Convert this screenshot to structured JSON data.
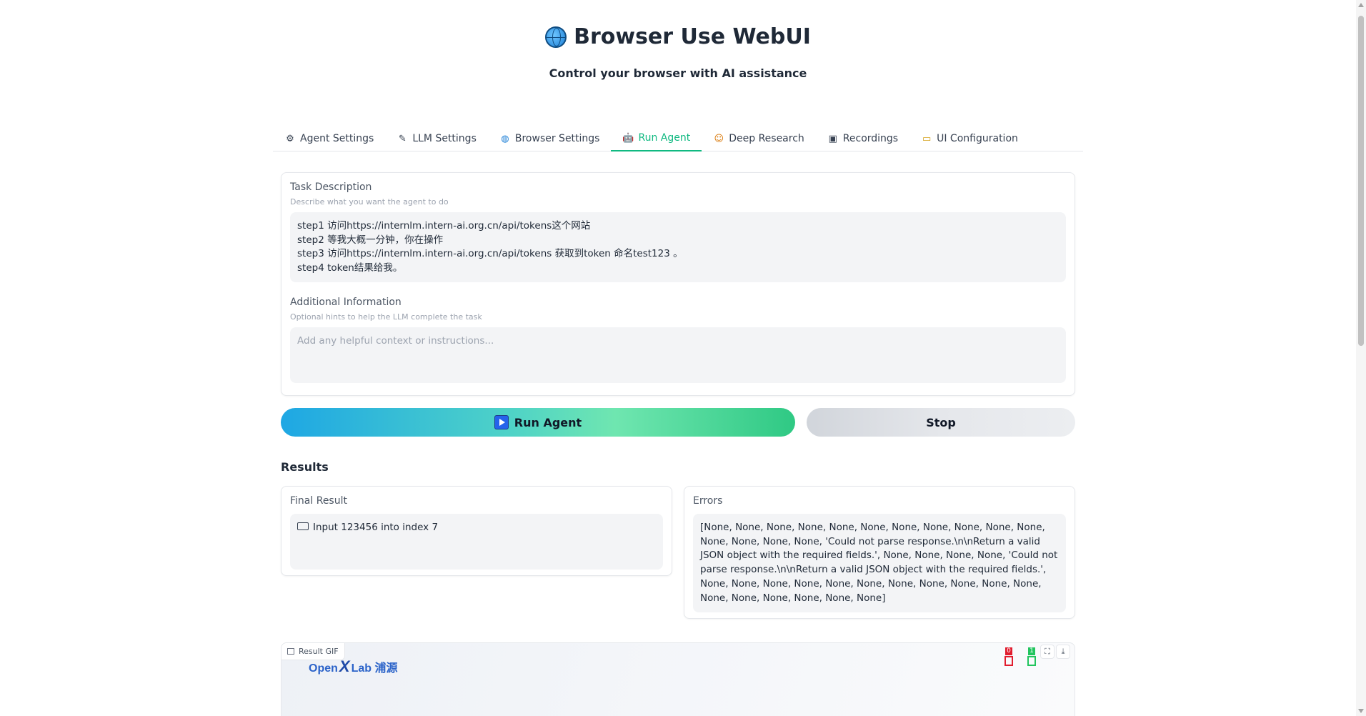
{
  "header": {
    "title": "Browser Use WebUI",
    "title_icon": "globe-icon",
    "subtitle": "Control your browser with AI assistance"
  },
  "tabs": [
    {
      "label": "Agent Settings",
      "icon": "gear-icon",
      "glyph": "⚙"
    },
    {
      "label": "LLM Settings",
      "icon": "pencil-icon",
      "glyph": "✎"
    },
    {
      "label": "Browser Settings",
      "icon": "globe-icon",
      "glyph": "◍"
    },
    {
      "label": "Run Agent",
      "icon": "robot-icon",
      "glyph": "🤖",
      "active": true
    },
    {
      "label": "Deep Research",
      "icon": "emoji-icon",
      "glyph": "☺"
    },
    {
      "label": "Recordings",
      "icon": "recorder-icon",
      "glyph": "▣"
    },
    {
      "label": "UI Configuration",
      "icon": "folder-icon",
      "glyph": "▭"
    }
  ],
  "task": {
    "label": "Task Description",
    "info": "Describe what you want the agent to do",
    "value": "step1 访问https://internlm.intern-ai.org.cn/api/tokens这个网站\nstep2 等我大概一分钟，你在操作\nstep3  访问https://internlm.intern-ai.org.cn/api/tokens 获取到token 命名test123 。\nstep4 token结果给我。"
  },
  "additional": {
    "label": "Additional Information",
    "info": "Optional hints to help the LLM complete the task",
    "placeholder": "Add any helpful context or instructions..."
  },
  "buttons": {
    "run_label": "Run Agent",
    "stop_label": "Stop"
  },
  "results": {
    "title": "Results",
    "final_label": "Final Result",
    "final_value": "Input 123456 into index 7",
    "errors_label": "Errors",
    "errors_value": "[None, None, None, None, None, None, None, None, None, None, None, None, None, None, None, 'Could not parse response.\\n\\nReturn a valid JSON object with the required fields.', None, None, None, None, 'Could not parse response.\\n\\nReturn a valid JSON object with the required fields.', None, None, None, None, None, None, None, None, None, None, None, None, None, None, None, None, None]"
  },
  "gif": {
    "label": "Result GIF",
    "brand_open": "Open",
    "brand_x": "X",
    "brand_lab": "Lab 浦源",
    "marker_left": "0",
    "marker_right": "1",
    "marker_left_color": "#e11d2e",
    "marker_right_color": "#22c55e",
    "fullscreen_icon": "⛶",
    "download_icon": "⤓"
  }
}
